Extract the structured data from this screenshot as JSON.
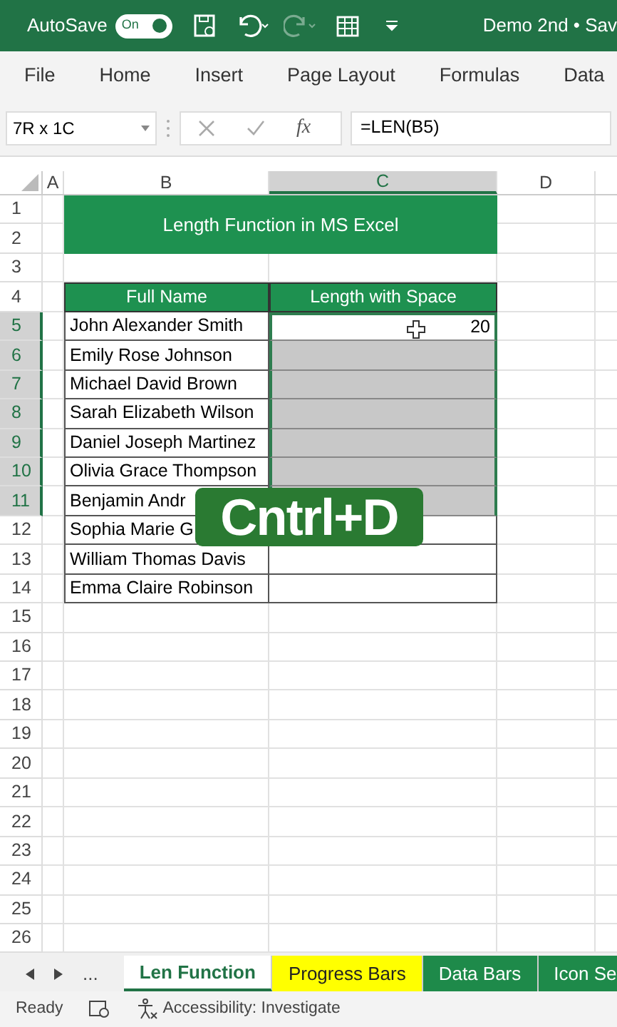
{
  "title_bar": {
    "autosave_label": "AutoSave",
    "autosave_toggle": {
      "label": "On",
      "on": true
    },
    "document_title": "Demo 2nd • Sav"
  },
  "ribbon_tabs": [
    "File",
    "Home",
    "Insert",
    "Page Layout",
    "Formulas",
    "Data"
  ],
  "formula_bar": {
    "name_box": "7R x 1C",
    "function_label": "fx",
    "formula": "=LEN(B5)"
  },
  "columns": [
    {
      "label": "A",
      "selected": false
    },
    {
      "label": "B",
      "selected": false
    },
    {
      "label": "C",
      "selected": true
    },
    {
      "label": "D",
      "selected": false
    }
  ],
  "row_numbers": [
    "1",
    "2",
    "3",
    "4",
    "5",
    "6",
    "7",
    "8",
    "9",
    "10",
    "11",
    "12",
    "13",
    "14",
    "15",
    "16",
    "17",
    "18",
    "19",
    "20",
    "21",
    "22",
    "23",
    "24",
    "25",
    "26"
  ],
  "sheet_title": "Length Function in MS Excel",
  "table": {
    "headers": [
      "Full Name",
      "Length with Space"
    ],
    "rows": [
      {
        "name": "John Alexander Smith",
        "length": "20",
        "selected": true,
        "active": true
      },
      {
        "name": "Emily Rose Johnson",
        "selected": true,
        "active": false
      },
      {
        "name": "Michael David Brown",
        "selected": true,
        "active": false
      },
      {
        "name": "Sarah Elizabeth Wilson",
        "selected": true,
        "active": false
      },
      {
        "name": "Daniel Joseph Martinez",
        "selected": true,
        "active": false
      },
      {
        "name": "Olivia Grace Thompson",
        "selected": true,
        "active": false
      },
      {
        "name": "Benjamin Andr",
        "selected": true,
        "active": false
      },
      {
        "name": "Sophia Marie G",
        "selected": false,
        "active": false
      },
      {
        "name": "William Thomas Davis",
        "selected": false,
        "active": false
      },
      {
        "name": "Emma Claire Robinson",
        "selected": false,
        "active": false
      }
    ]
  },
  "overlay_caption": "Cntrl+D",
  "sheet_tabs": {
    "more": "...",
    "tabs": [
      {
        "label": "Len Function",
        "selected": true,
        "color": "#217346"
      },
      {
        "label": "Progress Bars",
        "selected": false,
        "color": "#ffff00"
      },
      {
        "label": "Data Bars",
        "selected": false,
        "color": "#1e8a4a"
      },
      {
        "label": "Icon Se",
        "selected": false,
        "color": "#1e8a4a"
      }
    ]
  },
  "status_bar": {
    "status": "Ready",
    "accessibility": "Accessibility: Investigate"
  }
}
